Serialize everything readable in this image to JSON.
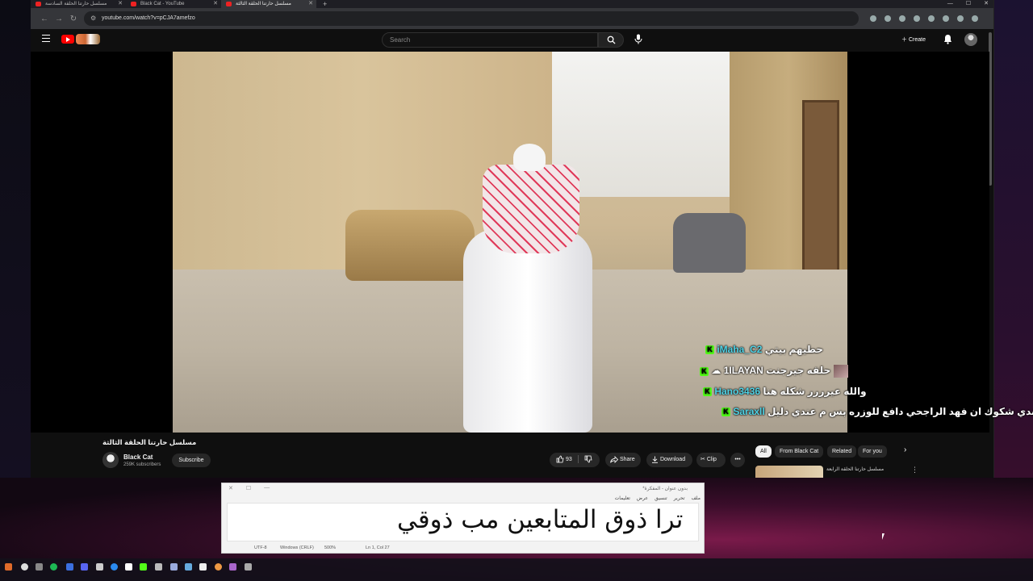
{
  "browser": {
    "tabs": [
      {
        "label": "مسلسل حارتنا الحلقة السادسة",
        "active": false
      },
      {
        "label": "Black Cat - YouTube",
        "active": false
      },
      {
        "label": "مسلسل حارتنا الحلقة الثالثة",
        "active": true
      }
    ],
    "url": "youtube.com/watch?v=pCJA7amefzo"
  },
  "youtube": {
    "search_placeholder": "Search",
    "create_label": "Create",
    "video_title": "مسلسل حارتنا الحلقة الثالثة",
    "channel_name": "Black Cat",
    "subscribers": "259K subscribers",
    "subscribe_label": "Subscribe",
    "like_count": "93",
    "share_label": "Share",
    "download_label": "Download",
    "clip_label": "Clip",
    "chips": [
      "All",
      "From Black Cat",
      "Related",
      "For you"
    ],
    "rec_title": "مسلسل حارتنا الحلقة الرابعة"
  },
  "chat": [
    {
      "user": "iMaha_C2",
      "message": "حطيهم بيتي"
    },
    {
      "user": "1ILAYAN",
      "message": "حلقه جيرجنت"
    },
    {
      "user": "Hano3436",
      "message": "والله عيرررر شكله هنا"
    },
    {
      "user": "Saraxll",
      "message": "عندي شكوك ان فهد الراجحي دافع للوزره بس م عندي دليل"
    }
  ],
  "notepad": {
    "title": "*بدون عنوان - المفكرة",
    "menu": [
      "ملف",
      "تحرير",
      "تنسيق",
      "عرض",
      "تعليمات"
    ],
    "text": "ترا ذوق المتابعين مب ذوقي",
    "status": {
      "position": "Ln 1, Col 27",
      "zoom": "500%",
      "line_ending": "Windows (CRLF)",
      "encoding": "UTF-8"
    }
  }
}
